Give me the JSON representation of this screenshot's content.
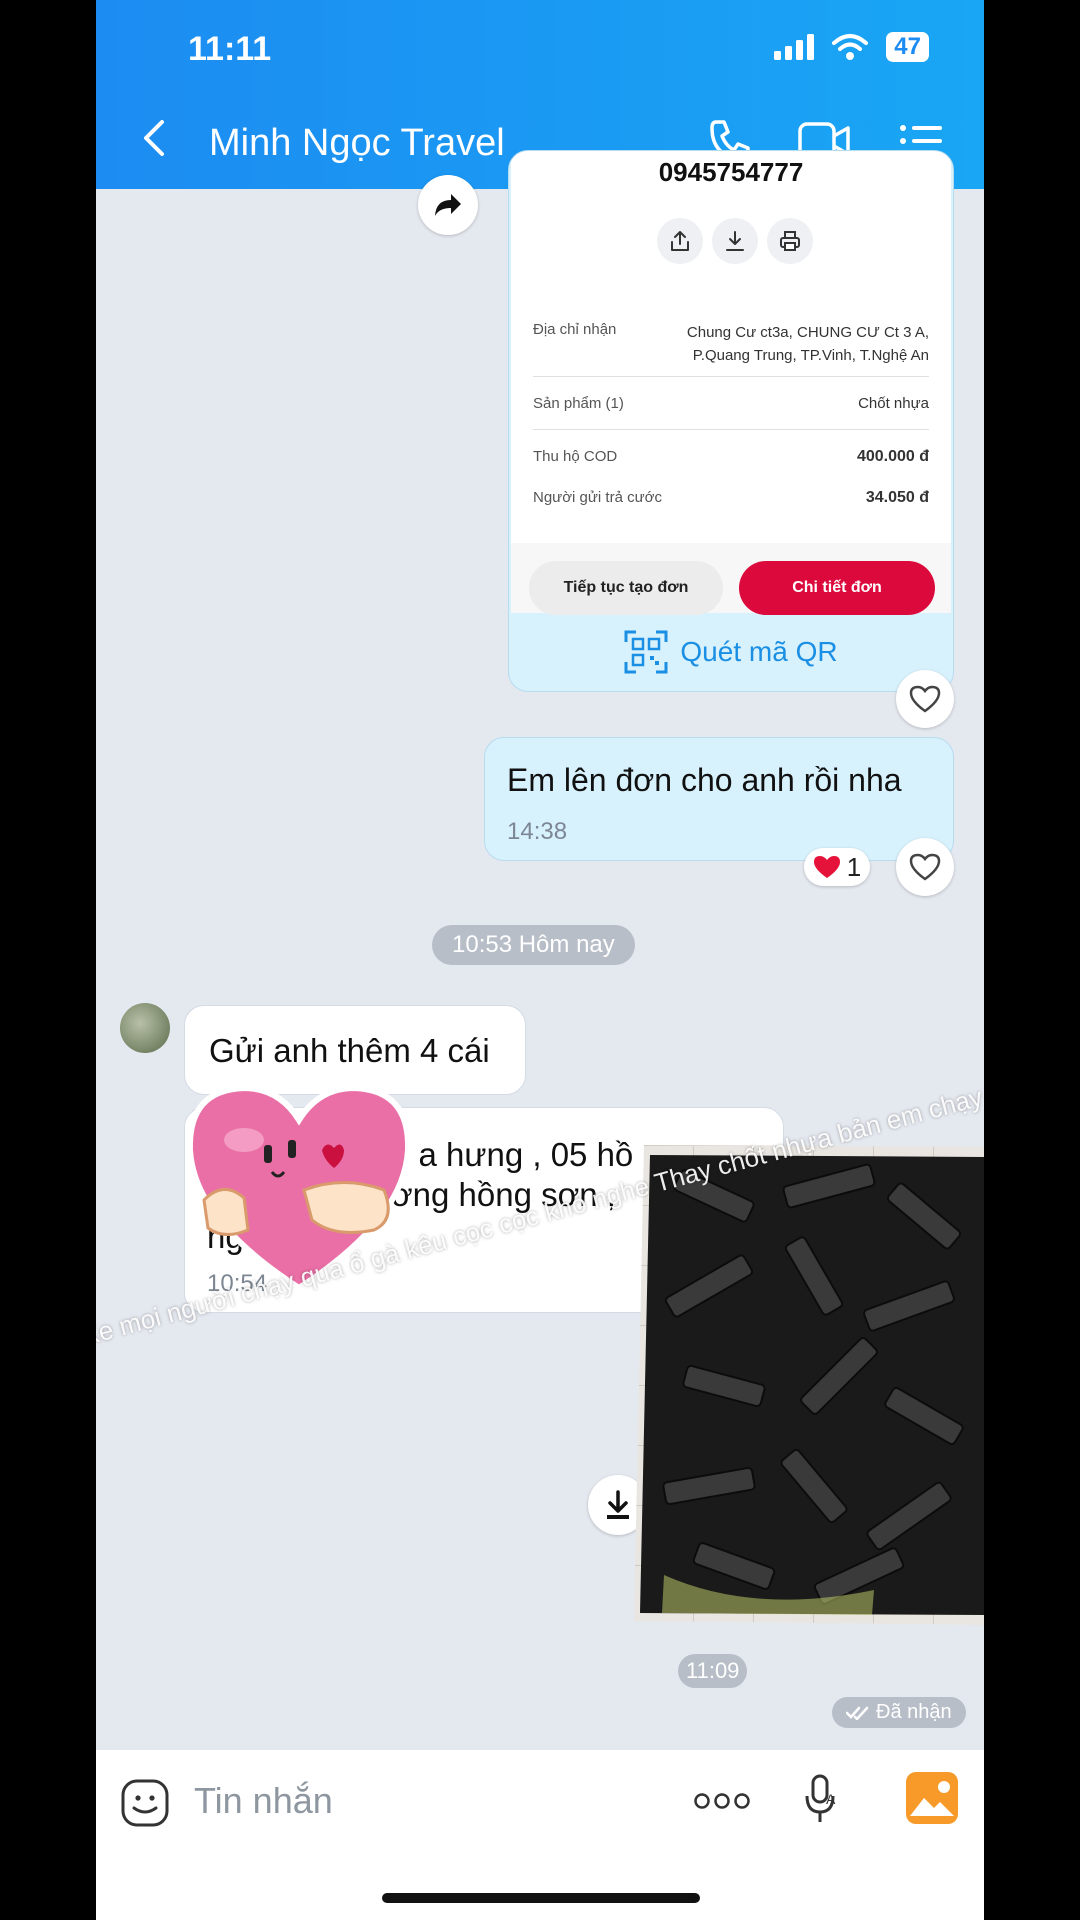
{
  "status": {
    "time": "11:11",
    "battery": "47"
  },
  "header": {
    "title": "Minh Ngọc Travel"
  },
  "card": {
    "phone": "0945754777",
    "rows": [
      {
        "label": "Địa chỉ nhận",
        "value": "Chung Cư ct3a, CHUNG CƯ Ct 3 A, P.Quang Trung, TP.Vinh, T.Nghệ An"
      },
      {
        "label": "Sản phẩm (1)",
        "value": "Chốt nhựa"
      },
      {
        "label": "Thu hộ COD",
        "value": "400.000 đ"
      },
      {
        "label": "Người gửi trả cước",
        "value": "34.050 đ"
      }
    ],
    "btn_continue": "Tiếp tục tạo đơn",
    "btn_detail": "Chi tiết đơn",
    "qr_label": "Quét mã QR"
  },
  "messages": {
    "sent_text": "Em lên đơn cho anh rồi nha",
    "sent_time": "14:38",
    "reaction_count": "1",
    "date_divider": "10:53 Hôm nay",
    "recv_1": "Gửi anh thêm 4 cái",
    "recv_2_line1_link": "8",
    "recv_2_line1": " a hưng , 05 hồ",
    "recv_2_line2": "ờng hồng sơn ,",
    "recv_2_line3": "ng",
    "recv_2_time": "10:54",
    "image_time": "11:09",
    "delivered": "Đã nhận"
  },
  "overlay": {
    "caption": "Xe mọi người chạy qua ổ gà kêu cọc cọc khó nghe Thay chốt nhựa bản em chạy ổ"
  },
  "input": {
    "placeholder": "Tin nhắn"
  },
  "colors": {
    "header": "#1c8cf2",
    "accent": "#1a8fe3",
    "detail_button": "#dc0a3c"
  }
}
